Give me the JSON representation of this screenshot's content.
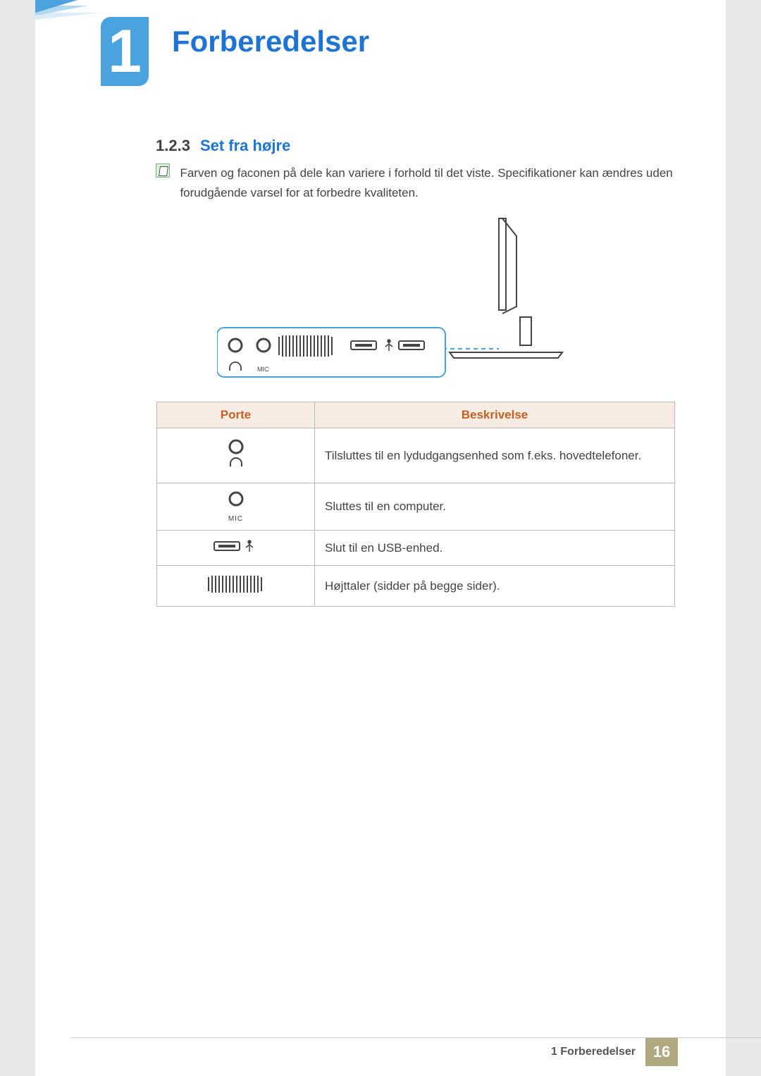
{
  "chapter": {
    "number": "1",
    "title": "Forberedelser"
  },
  "section": {
    "number": "1.2.3",
    "title": "Set fra højre"
  },
  "note": "Farven og faconen på dele kan variere i forhold til det viste. Specifikationer kan ændres uden forudgående varsel for at forbedre kvaliteten.",
  "diagram_labels": {
    "mic": "MIC"
  },
  "table": {
    "headers": {
      "port": "Porte",
      "desc": "Beskrivelse"
    },
    "rows": [
      {
        "port_icon": "headphone",
        "desc": "Tilsluttes til en lydudgangsenhed som f.eks. hovedtelefoner."
      },
      {
        "port_icon": "mic",
        "port_label": "MIC",
        "desc": "Sluttes til en computer."
      },
      {
        "port_icon": "usb",
        "desc": "Slut til en USB-enhed."
      },
      {
        "port_icon": "speaker",
        "desc": "Højttaler (sidder på begge sider)."
      }
    ]
  },
  "footer": {
    "label": "1 Forberedelser",
    "page": "16"
  }
}
